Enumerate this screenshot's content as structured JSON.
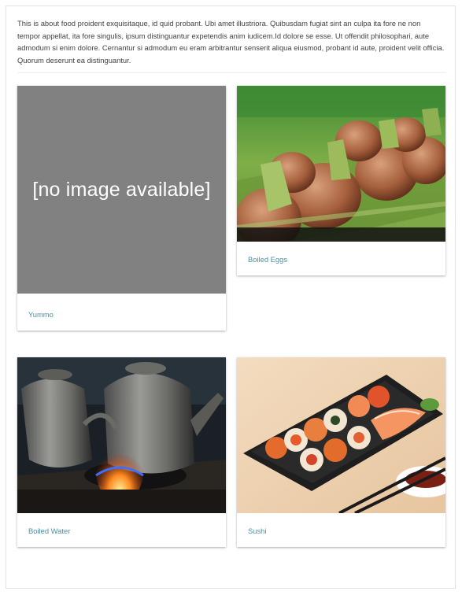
{
  "intro_text": "This is about food proident exquisitaque, id quid probant. Ubi amet illustriora. Quibusdam fugiat sint an culpa ita fore ne non tempor appellat, ita fore singulis, ipsum distinguantur expetendis anim iudicem.Id dolore se esse. Ut offendit philosophari, aute admodum si enim dolore. Cernantur si admodum eu eram arbitrantur senserit aliqua eiusmod, probant id aute, proident velit officia. Quorum deserunt ea distinguantur.",
  "cards": [
    {
      "label": "Yummo",
      "image_placeholder": "[no image available]"
    },
    {
      "label": "Boiled Eggs"
    },
    {
      "label": "Boiled Water"
    },
    {
      "label": "Sushi"
    }
  ],
  "colors": {
    "link": "#4b8fa3",
    "placeholder_bg": "#818181",
    "text": "#424242"
  }
}
